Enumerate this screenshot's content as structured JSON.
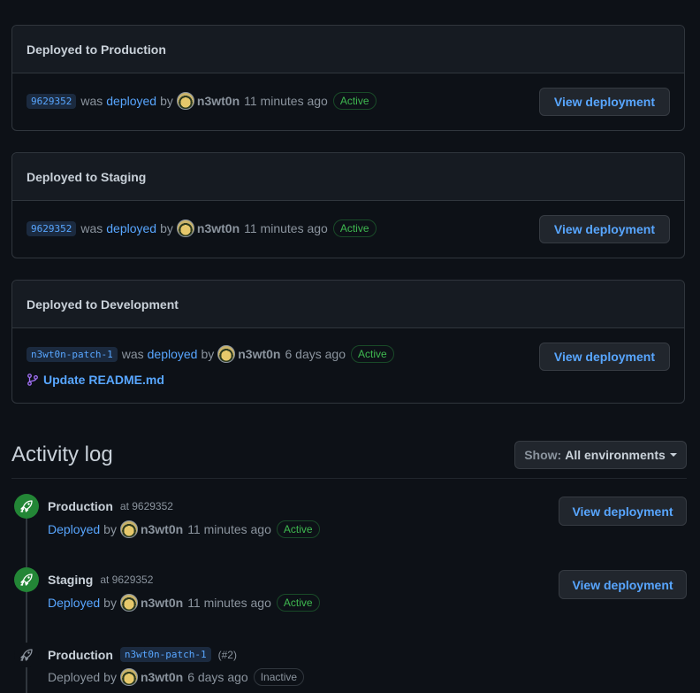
{
  "deployments": [
    {
      "title": "Deployed to Production",
      "sha": "9629352",
      "was": "was",
      "deployed": "deployed",
      "by": "by",
      "user": "n3wt0n",
      "time": "11 minutes ago",
      "status": "Active",
      "button": "View deployment"
    },
    {
      "title": "Deployed to Staging",
      "sha": "9629352",
      "was": "was",
      "deployed": "deployed",
      "by": "by",
      "user": "n3wt0n",
      "time": "11 minutes ago",
      "status": "Active",
      "button": "View deployment"
    },
    {
      "title": "Deployed to Development",
      "sha": "n3wt0n-patch-1",
      "was": "was",
      "deployed": "deployed",
      "by": "by",
      "user": "n3wt0n",
      "time": "6 days ago",
      "status": "Active",
      "button": "View deployment",
      "commit": "Update README.md"
    }
  ],
  "activity": {
    "heading": "Activity log",
    "filter_label": "Show:",
    "filter_value": "All environments",
    "entries": [
      {
        "env": "Production",
        "at": "at 9629352",
        "deployed": "Deployed",
        "by": "by",
        "user": "n3wt0n",
        "time": "11 minutes ago",
        "status": "Active",
        "button": "View deployment"
      },
      {
        "env": "Staging",
        "at": "at 9629352",
        "deployed": "Deployed",
        "by": "by",
        "user": "n3wt0n",
        "time": "11 minutes ago",
        "status": "Active",
        "button": "View deployment"
      },
      {
        "env": "Production",
        "ref": "n3wt0n-patch-1",
        "pr": "(#2)",
        "deployed": "Deployed",
        "by": "by",
        "user": "n3wt0n",
        "time": "6 days ago",
        "status": "Inactive"
      }
    ]
  },
  "colors": {
    "accent": "#58a6ff",
    "success": "#3fb950",
    "background": "#0d1117"
  }
}
